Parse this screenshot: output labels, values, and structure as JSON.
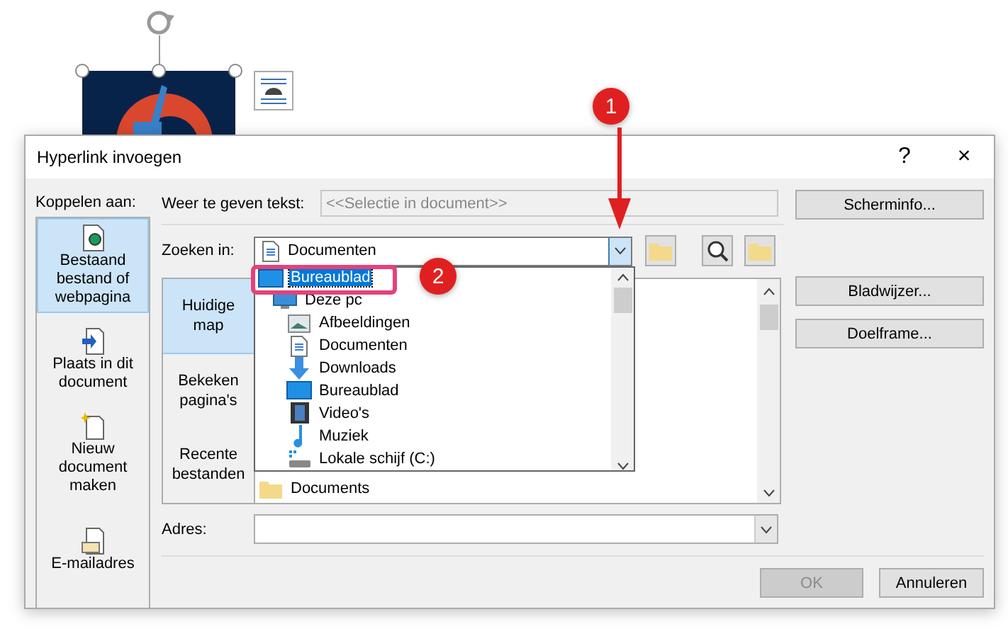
{
  "dialog": {
    "title": "Hyperlink invoegen",
    "help": "?",
    "close": "×"
  },
  "link_to": {
    "label": "Koppelen aan:",
    "items": [
      {
        "kind": "file",
        "label": "Bestaand bestand of webpagina",
        "selected": true
      },
      {
        "kind": "place",
        "label": "Plaats in dit document",
        "selected": false
      },
      {
        "kind": "new",
        "label": "Nieuw document maken",
        "selected": false
      },
      {
        "kind": "mail",
        "label": "E-mailadres",
        "selected": false
      }
    ]
  },
  "display_text": {
    "label": "Weer te geven tekst:",
    "value": "<<Selectie in document>>"
  },
  "buttons_top": [
    "Scherminfo..."
  ],
  "look_in": {
    "label": "Zoeken in:",
    "value": "Documenten",
    "open": true,
    "items": [
      {
        "kind": "desktop",
        "label": "Bureaublad",
        "selected": true,
        "children": [
          {
            "kind": "pc",
            "label": "Deze pc",
            "selected": false,
            "children": [
              {
                "kind": "pictures",
                "label": "Afbeeldingen",
                "selected": false
              },
              {
                "kind": "documents",
                "label": "Documenten",
                "selected": false
              },
              {
                "kind": "downloads",
                "label": "Downloads",
                "selected": false
              },
              {
                "kind": "desktop",
                "label": "Bureaublad",
                "selected": false
              },
              {
                "kind": "video",
                "label": "Video's",
                "selected": false
              },
              {
                "kind": "music",
                "label": "Muziek",
                "selected": false
              },
              {
                "kind": "drive",
                "label": "Lokale schijf (C:)",
                "selected": false
              }
            ]
          }
        ]
      }
    ]
  },
  "nav": [
    {
      "label": "Huidige map",
      "selected": true
    },
    {
      "label": "Bekeken pagina's",
      "selected": false
    },
    {
      "label": "Recente bestanden",
      "selected": false
    }
  ],
  "files": [
    "Documents"
  ],
  "side_buttons": [
    "Bladwijzer...",
    "Doelframe..."
  ],
  "address": {
    "label": "Adres:"
  },
  "footer_buttons": [
    {
      "label": "OK",
      "disabled": true
    },
    {
      "label": "Annuleren",
      "disabled": false
    }
  ],
  "annotations": [
    {
      "label": "1"
    },
    {
      "label": "2"
    }
  ]
}
